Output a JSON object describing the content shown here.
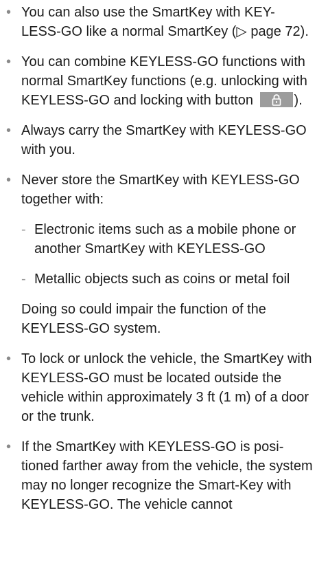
{
  "items": [
    {
      "text": "You can also use the SmartKey with KEY-LESS-GO like a normal SmartKey (▷ page 72)."
    },
    {
      "text_before": "You can combine KEYLESS-GO functions with normal SmartKey functions (e.g. unlocking with KEYLESS-GO and locking with button",
      "text_after": ")."
    },
    {
      "text": "Always carry the SmartKey with KEYLESS-GO with you."
    },
    {
      "text": "Never store the SmartKey with KEYLESS-GO together with:",
      "subitems": [
        "Electronic items such as a mobile phone or another SmartKey with KEYLESS-GO",
        "Metallic objects such as coins or metal foil"
      ]
    }
  ],
  "note": "Doing so could impair the function of the KEYLESS-GO system.",
  "items2": [
    {
      "text": "To lock or unlock the vehicle, the SmartKey with KEYLESS-GO must be located outside the vehicle within approximately 3 ft (1 m) of a door or the trunk."
    },
    {
      "text": "If the SmartKey with KEYLESS-GO is posi-tioned farther away from the vehicle, the system may no longer recognize the Smart-Key with KEYLESS-GO. The vehicle cannot"
    }
  ],
  "icons": {
    "lock_button": "lock-icon"
  },
  "colors": {
    "button_bg": "#9c9c9c",
    "bullet": "#8a8a8a",
    "text": "#1c1c1c"
  }
}
